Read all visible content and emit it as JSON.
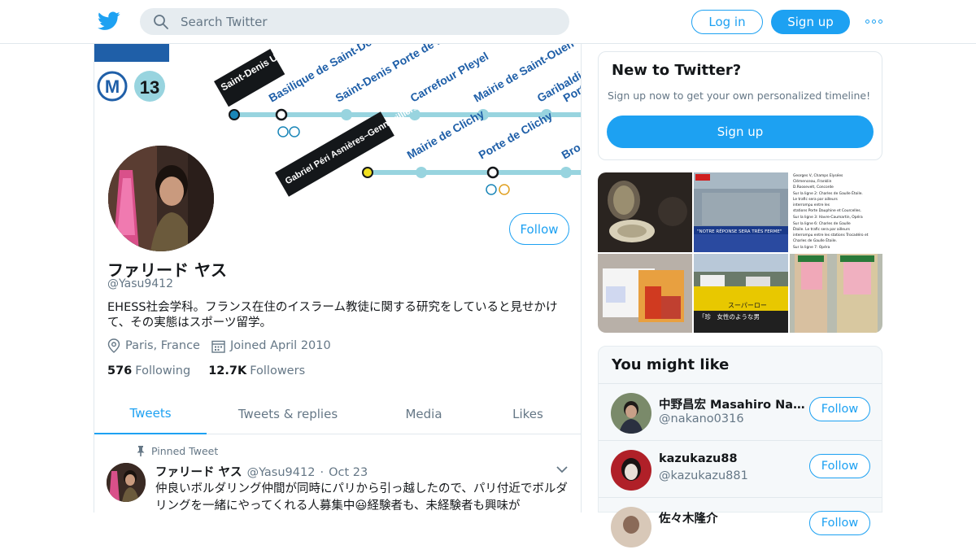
{
  "header": {
    "search_placeholder": "Search Twitter",
    "login_label": "Log in",
    "signup_label": "Sign up"
  },
  "banner": {
    "line_number": "13",
    "metro_letter": "M",
    "stations_top": [
      "Saint-Denis Université",
      "Basilique de Saint-Denis",
      "Saint-Denis Porte de Paris",
      "Carrefour Pleyel",
      "Mairie de Saint-Ouen",
      "Garibaldi",
      "Porte"
    ],
    "stations_bottom": [
      "Gabriel Péri Asnières–Gennevilliers",
      "Mairie de Clichy",
      "Porte de Clichy",
      "Bro"
    ]
  },
  "profile": {
    "name": "ファリード ヤス",
    "handle": "@Yasu9412",
    "bio": "EHESS社会学科。フランス在住のイスラーム教徒に関する研究をしていると見せかけて、その実態はスポーツ留学。",
    "location": "Paris, France",
    "joined": "Joined April 2010",
    "following_count": "576",
    "following_label": "Following",
    "followers_count": "12.7K",
    "followers_label": "Followers",
    "follow_label": "Follow"
  },
  "tabs": [
    "Tweets",
    "Tweets & replies",
    "Media",
    "Likes"
  ],
  "pinned_tweet": {
    "pinned_label": "Pinned Tweet",
    "name": "ファリード ヤス",
    "handle": "@Yasu9412",
    "date": "Oct 23",
    "text": "仲良いボルダリング仲間が同時にパリから引っ越したので、パリ付近でボルダリングを一緒にやってくれる人募集中😃経験者も、未経験者も興味が"
  },
  "new_to_twitter": {
    "title": "New to Twitter?",
    "subtitle": "Sign up now to get your own personalized timeline!",
    "signup_label": "Sign up"
  },
  "media_tiles": {
    "news_banner": "\"NOTRE RÉPONSE SERA TRÈS FERME\"",
    "text_lines": [
      "Georges V, Champs Elysées",
      "Clémenceau, Franklin",
      "D.Roosevelt, Concorde",
      "Sur la ligne 2: Charles de Gaulle Étoile.",
      "Le trafic sera par ailleurs",
      "interrompu entre les",
      "stations Porte Dauphine et Courcelles.",
      "Sur la ligne 3: Havre-Caumartin, Opéra",
      "Sur la ligne 6: Charles de Gaulle",
      "Étoile. Le trafic sera par ailleurs",
      "interrompu entre les stations Trocadéro et",
      "Charles de Gaulle Étoile.",
      "Sur la ligne 7: Opéra"
    ],
    "caption_store": "「珍　女性のような男",
    "store_sign": "スーパーロー"
  },
  "you_might_like": {
    "title": "You might like",
    "users": [
      {
        "name": "中野昌宏 Masahiro Nakano",
        "handle": "@nakano0316",
        "follow": "Follow"
      },
      {
        "name": "kazukazu88",
        "handle": "@kazukazu881",
        "follow": "Follow"
      },
      {
        "name": "佐々木隆介",
        "handle": "",
        "follow": "Follow"
      }
    ]
  },
  "colors": {
    "accent": "#1da1f2",
    "metro_line": "#98d4df",
    "gray_text": "#657786"
  }
}
